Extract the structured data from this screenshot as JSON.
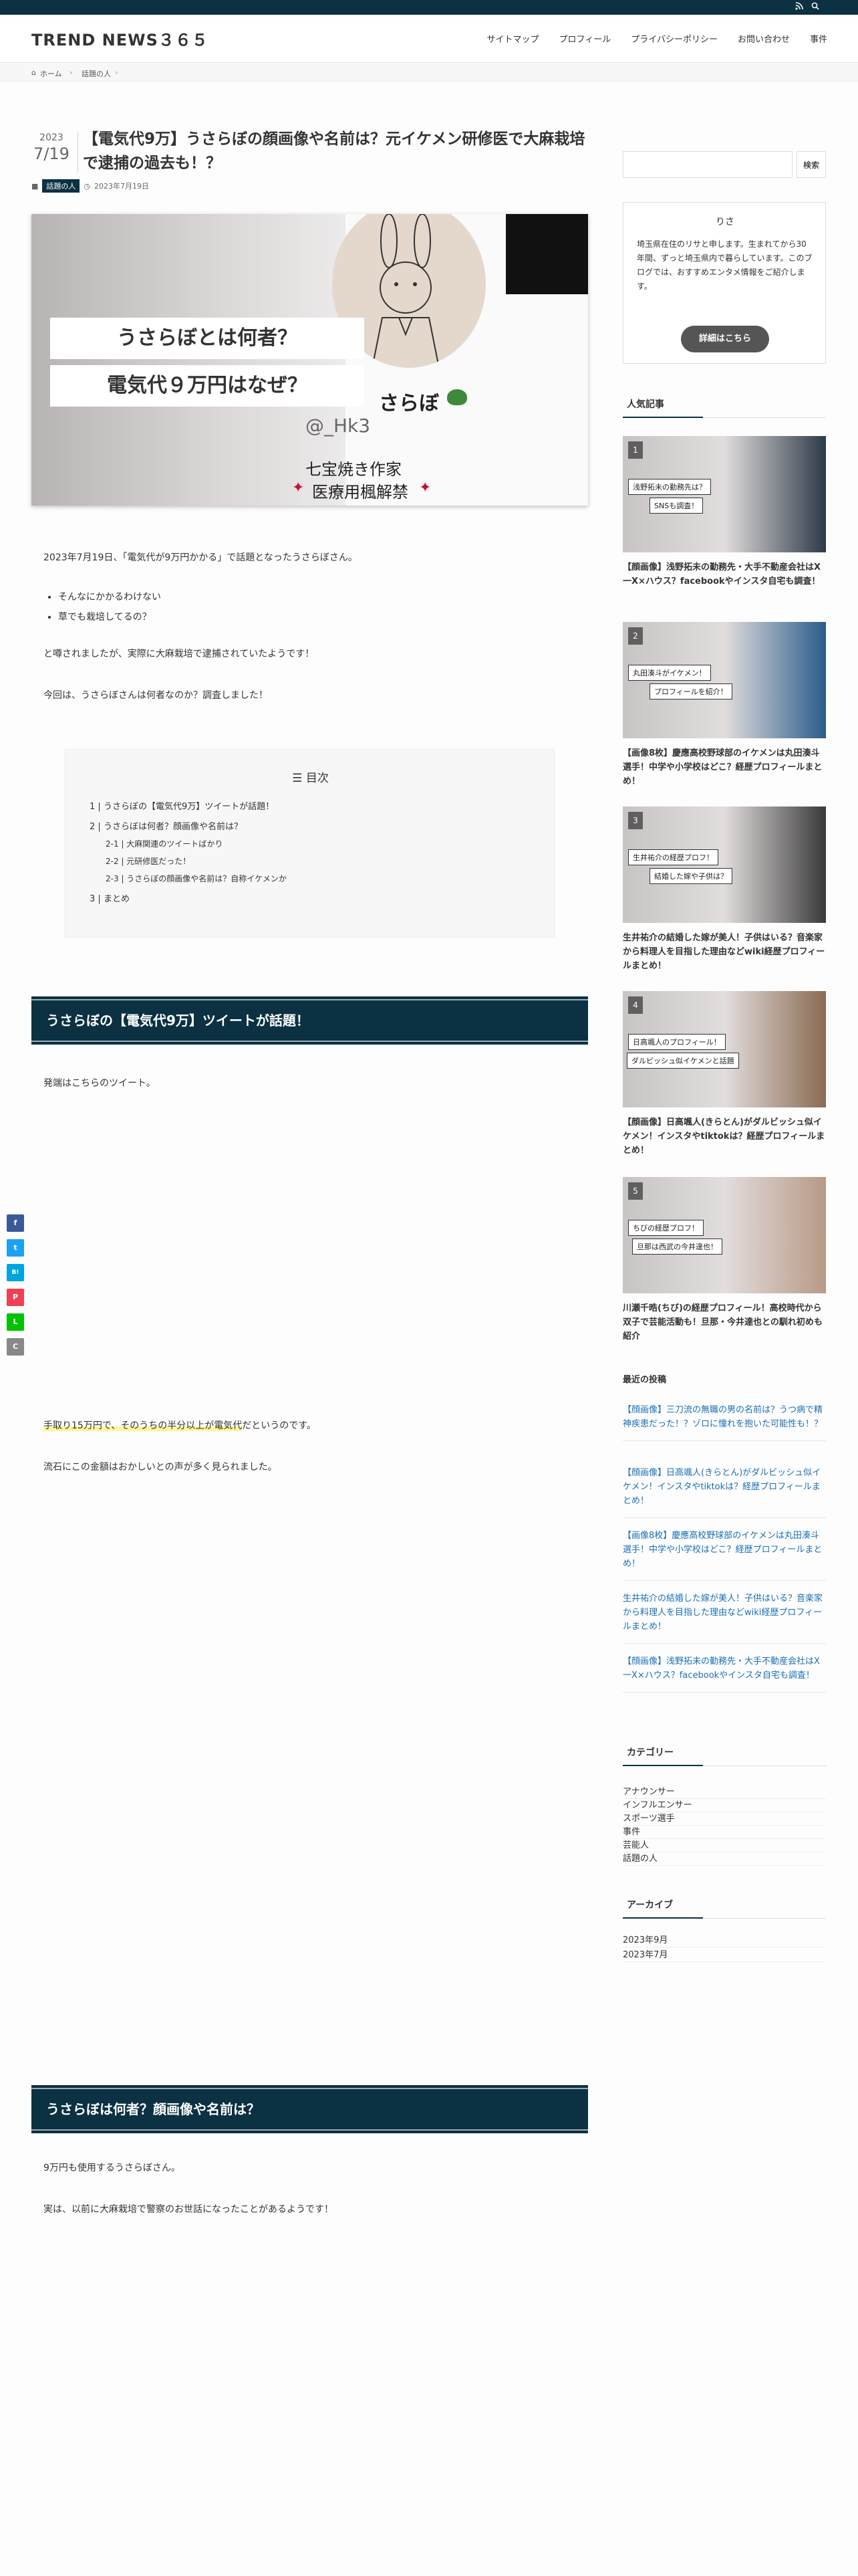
{
  "topbar": {
    "rss_icon": "rss-icon",
    "search_icon": "search-icon"
  },
  "site": {
    "logo": "TREND NEWS３６５"
  },
  "nav": [
    "サイトマップ",
    "プロフィール",
    "プライバシーポリシー",
    "お問い合わせ",
    "事件"
  ],
  "breadcrumb": {
    "home": "ホーム",
    "cat": "話題の人"
  },
  "post": {
    "year": "2023",
    "date": "7/19",
    "title": "【電気代9万】うさらぼの顔画像や名前は？元イケメン研修医で大麻栽培で逮捕の過去も！？",
    "category": "話題の人",
    "published": "2023年7月19日",
    "eyecatch": {
      "line1": "うさらぼとは何者？",
      "line2": "電気代９万円はなぜ？",
      "name": "さらぼ",
      "handle": "@_Hk3",
      "line3": "七宝焼き作家",
      "line4": "医療用楓解禁"
    },
    "p1": "2023年7月19日、「電気代が9万円かかる」で話題となったうさらぼさん。",
    "bullets": [
      "そんなにかかるわけない",
      "草でも栽培してるの？"
    ],
    "p2": "と噂されましたが、実際に大麻栽培で逮捕されていたようです！",
    "p3": "今回は、うさらぼさんは何者なのか？調査しました！",
    "toc": {
      "heading": "目次",
      "items": [
        {
          "num": "1",
          "text": "うさらぼの【電気代9万】ツイートが話題！"
        },
        {
          "num": "2",
          "text": "うさらぼは何者？顔画像や名前は？"
        },
        {
          "num": "2-1",
          "text": "大麻関連のツイートばかり"
        },
        {
          "num": "2-2",
          "text": "元研修医だった！"
        },
        {
          "num": "2-3",
          "text": "うさらぼの顔画像や名前は？自称イケメンか"
        },
        {
          "num": "3",
          "text": "まとめ"
        }
      ]
    },
    "h2a": "うさらぼの【電気代9万】ツイートが話題！",
    "p4": "発端はこちらのツイート。",
    "p5_mark": "手取り15万円で、そのうちの半分以上が電気代",
    "p5_rest": "だというのです。",
    "p6": "流石にこの金額はおかしいとの声が多く見られました。",
    "h2b": "うさらぼは何者？顔画像や名前は？",
    "p7": "9万円も使用するうさらぼさん。",
    "p8": "実は、以前に大麻栽培で警察のお世話になったことがあるようです！"
  },
  "sidebar": {
    "search_button": "検索",
    "profile": {
      "name": "りさ",
      "text": "埼玉県在住のリサと申します。生まれてから30年間、ずっと埼玉県内で暮らしています。このブログでは、おすすめエンタメ情報をご紹介します。",
      "button": "詳細はこちら"
    },
    "popular_heading": "人気記事",
    "popular": [
      {
        "rank": "1",
        "b1": "浅野拓未の勤務先は？",
        "b2": "SNSも調査！",
        "title": "【顔画像】浅野拓未の勤務先・大手不動産会社はX一X×ハウス？facebookやインスタ自宅も調査！"
      },
      {
        "rank": "2",
        "b1": "丸田湊斗がイケメン！",
        "b2": "プロフィールを紹介！",
        "title": "【画像8枚】慶應高校野球部のイケメンは丸田湊斗選手！中学や小学校はどこ？経歴プロフィールまとめ！"
      },
      {
        "rank": "3",
        "b1": "生井祐介の経歴プロフ！",
        "b2": "結婚した嫁や子供は？",
        "title": "生井祐介の結婚した嫁が美人！子供はいる？音楽家から料理人を目指した理由などwiki経歴プロフィールまとめ！"
      },
      {
        "rank": "4",
        "b1": "日高颯人のプロフィール！",
        "b2": "ダルビッシュ似イケメンと話題",
        "title": "【顔画像】日高颯人(きらとん)がダルビッシュ似イケメン！インスタやtiktokは？経歴プロフィールまとめ！"
      },
      {
        "rank": "5",
        "b1": "ちびの経歴プロフ！",
        "b2": "旦那は西武の今井達也！",
        "title": "川瀬千晧(ちび)の経歴プロフィール！高校時代から双子で芸能活動も！旦那・今井達也との馴れ初めも紹介"
      }
    ],
    "recent_heading": "最近の投稿",
    "recent": [
      "【顔画像】三刀流の無職の男の名前は？うつ病で精神疾患だった！？ゾロに憧れを抱いた可能性も！？",
      "【顔画像】日高颯人(きらとん)がダルビッシュ似イケメン！インスタやtiktokは？経歴プロフィールまとめ！",
      "【画像8枚】慶應高校野球部のイケメンは丸田湊斗選手！中学や小学校はどこ？経歴プロフィールまとめ！",
      "生井祐介の結婚した嫁が美人！子供はいる？音楽家から料理人を目指した理由などwiki経歴プロフィールまとめ！",
      "【顔画像】浅野拓未の勤務先・大手不動産会社はX一X×ハウス？facebookやインスタ自宅も調査！"
    ],
    "cat_heading": "カテゴリー",
    "cats": [
      "アナウンサー",
      "インフルエンサー",
      "スポーツ選手",
      "事件",
      "芸能人",
      "話題の人"
    ],
    "archive_heading": "アーカイブ",
    "archives": [
      "2023年9月",
      "2023年7月"
    ]
  },
  "share": [
    "f",
    "t",
    "B!",
    "P",
    "L",
    "C"
  ]
}
